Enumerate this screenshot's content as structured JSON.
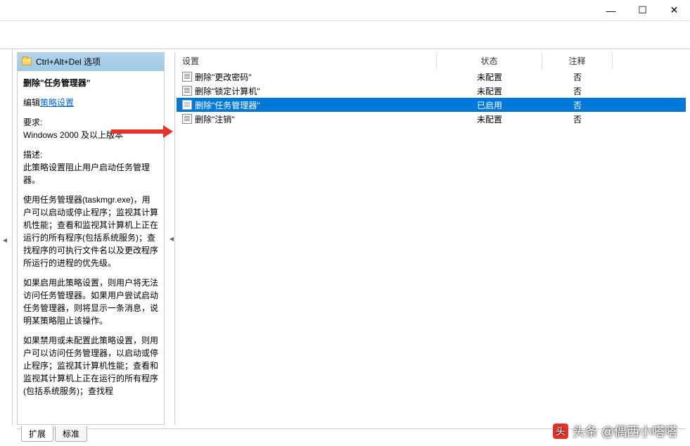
{
  "window": {
    "minimize": "—",
    "maximize": "☐",
    "close": "✕"
  },
  "header": {
    "title": "Ctrl+Alt+Del 选项"
  },
  "details": {
    "title": "删除\"任务管理器\"",
    "editPrefix": "编辑",
    "editLink": "策略设置",
    "requirementsLabel": "要求:",
    "requirements": "Windows 2000 及以上版本",
    "descriptionLabel": "描述:",
    "descP1": "此策略设置阻止用户启动任务管理器。",
    "descP2": "使用任务管理器(taskmgr.exe)，用户可以启动或停止程序；监视其计算机性能；查看和监视其计算机上正在运行的所有程序(包括系统服务)；查找程序的可执行文件名以及更改程序所运行的进程的优先级。",
    "descP3": "如果启用此策略设置，则用户将无法访问任务管理器。如果用户尝试启动任务管理器，则将显示一条消息，说明某策略阻止该操作。",
    "descP4": "如果禁用或未配置此策略设置，则用户可以访问任务管理器，以启动或停止程序；监视其计算机性能；查看和监视其计算机上正在运行的所有程序(包括系统服务)；查找程"
  },
  "columns": {
    "setting": "设置",
    "status": "状态",
    "comment": "注释"
  },
  "policies": [
    {
      "name": "删除\"更改密码\"",
      "status": "未配置",
      "comment": "否"
    },
    {
      "name": "删除\"锁定计算机\"",
      "status": "未配置",
      "comment": "否"
    },
    {
      "name": "删除\"任务管理器\"",
      "status": "已启用",
      "comment": "否"
    },
    {
      "name": "删除\"注销\"",
      "status": "未配置",
      "comment": "否"
    }
  ],
  "tabs": {
    "extended": "扩展",
    "standard": "标准"
  },
  "watermark": {
    "text": "头条 @偶西小嗒嗒"
  }
}
